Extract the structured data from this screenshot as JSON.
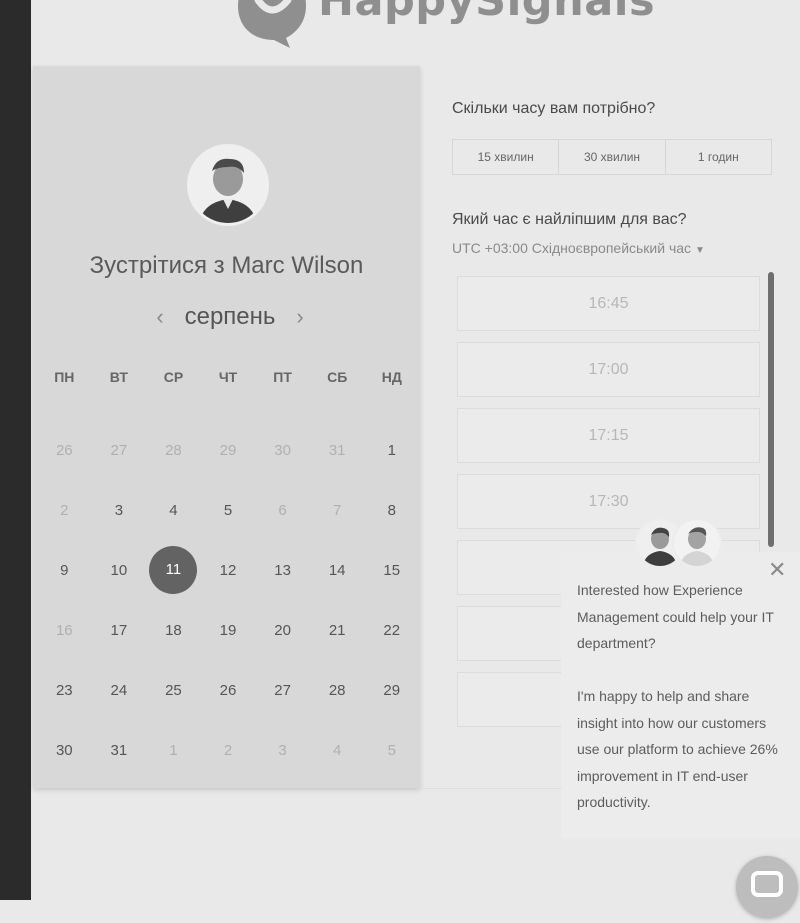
{
  "brand": {
    "name": "HappySignals"
  },
  "calendar": {
    "title_prefix": "Зустрітися з",
    "host_name": "Marc Wilson",
    "month": "серпень",
    "weekdays": [
      "ПН",
      "ВТ",
      "СР",
      "ЧТ",
      "ПТ",
      "СБ",
      "НД"
    ],
    "weeks": [
      [
        {
          "d": "26",
          "m": true
        },
        {
          "d": "27",
          "m": true
        },
        {
          "d": "28",
          "m": true
        },
        {
          "d": "29",
          "m": true
        },
        {
          "d": "30",
          "m": true
        },
        {
          "d": "31",
          "m": true
        },
        {
          "d": "1"
        }
      ],
      [
        {
          "d": "2",
          "m": true
        },
        {
          "d": "3"
        },
        {
          "d": "4"
        },
        {
          "d": "5"
        },
        {
          "d": "6",
          "m": true
        },
        {
          "d": "7",
          "m": true
        },
        {
          "d": "8"
        }
      ],
      [
        {
          "d": "9"
        },
        {
          "d": "10"
        },
        {
          "d": "11",
          "sel": true
        },
        {
          "d": "12"
        },
        {
          "d": "13"
        },
        {
          "d": "14"
        },
        {
          "d": "15"
        }
      ],
      [
        {
          "d": "16",
          "m": true
        },
        {
          "d": "17"
        },
        {
          "d": "18"
        },
        {
          "d": "19"
        },
        {
          "d": "20"
        },
        {
          "d": "21"
        },
        {
          "d": "22"
        }
      ],
      [
        {
          "d": "23"
        },
        {
          "d": "24"
        },
        {
          "d": "25"
        },
        {
          "d": "26"
        },
        {
          "d": "27"
        },
        {
          "d": "28"
        },
        {
          "d": "29"
        }
      ],
      [
        {
          "d": "30"
        },
        {
          "d": "31"
        },
        {
          "d": "1",
          "m": true
        },
        {
          "d": "2",
          "m": true
        },
        {
          "d": "3",
          "m": true
        },
        {
          "d": "4",
          "m": true
        },
        {
          "d": "5",
          "m": true
        }
      ]
    ]
  },
  "booking": {
    "duration_question": "Скільки часу вам потрібно?",
    "durations": [
      "15 хвилин",
      "30 хвилин",
      "1 годин"
    ],
    "time_question": "Який час є найліпшим для вас?",
    "timezone": "UTC +03:00 Східноєвропейський час",
    "slots": [
      "16:45",
      "17:00",
      "17:15",
      "17:30",
      "",
      "",
      ""
    ]
  },
  "chat": {
    "message_1": "Interested how Experience Management could help your IT department?",
    "message_2": "I'm happy to help and share insight into how our customers use our platform to achieve 26% improvement in IT end-user productivity."
  },
  "icons": {
    "prev": "chevron-left-icon",
    "next": "chevron-right-icon",
    "close": "close-icon",
    "caret": "caret-down-icon",
    "chat": "chat-bubble-icon"
  },
  "colors": {
    "selected_day": "#636363",
    "card_bg": "#d8d8d8",
    "page_bg": "#e9e9e9"
  }
}
